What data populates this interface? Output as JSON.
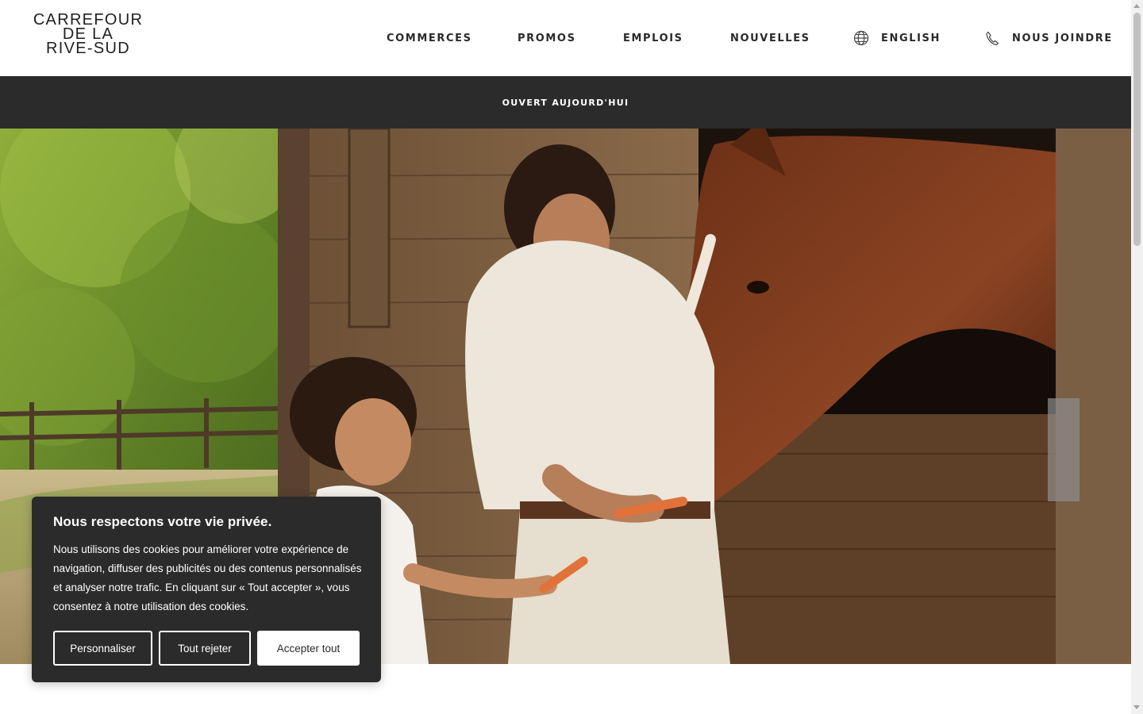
{
  "header": {
    "logo_lines": [
      "CARREFOUR",
      "DE LA",
      "RIVE-SUD"
    ],
    "nav": {
      "commerces": "COMMERCES",
      "promos": "PROMOS",
      "emplois": "EMPLOIS",
      "nouvelles": "NOUVELLES",
      "language": "ENGLISH",
      "contact": "NOUS JOINDRE"
    },
    "icons": {
      "language": "globe-icon",
      "contact": "phone-icon"
    }
  },
  "open_bar": {
    "text": "OUVERT AUJOURD'HUI"
  },
  "cookie_banner": {
    "title": "Nous respectons votre vie privée.",
    "body": "Nous utilisons des cookies pour améliorer votre expérience de navigation, diffuser des publicités ou des contenus personnalisés et analyser notre trafic. En cliquant sur « Tout accepter », vous consentez à notre utilisation des cookies.",
    "buttons": {
      "customize": "Personnaliser",
      "reject": "Tout rejeter",
      "accept": "Accepter tout"
    }
  },
  "colors": {
    "dark_bar": "#2b2b2b",
    "header_bg": "#ffffff",
    "nav_text": "#2a2a2a",
    "cookie_bg": "#2b2b2b",
    "accent_white": "#ffffff"
  }
}
